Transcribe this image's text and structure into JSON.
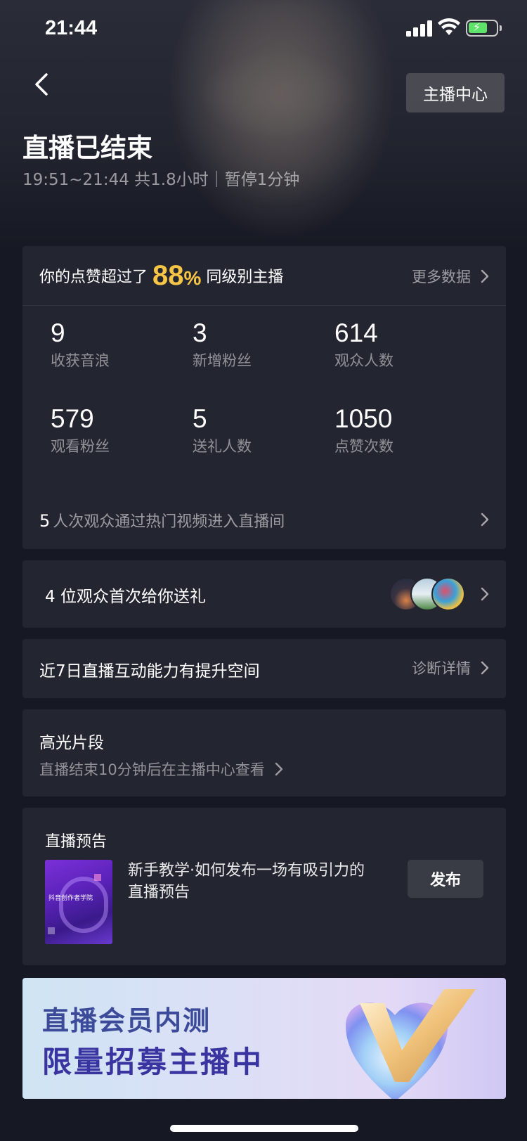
{
  "status_bar": {
    "time": "21:44"
  },
  "header": {
    "host_center_label": "主播中心",
    "title": "直播已结束",
    "subtitle": "19:51~21:44 共1.8小时｜暂停1分钟"
  },
  "summary": {
    "prefix": "你的点赞超过了",
    "percent": "88",
    "percent_unit": "%",
    "suffix": "同级别主播",
    "more_label": "更多数据",
    "stats": [
      {
        "value": "9",
        "label": "收获音浪"
      },
      {
        "value": "3",
        "label": "新增粉丝"
      },
      {
        "value": "614",
        "label": "观众人数"
      },
      {
        "value": "579",
        "label": "观看粉丝"
      },
      {
        "value": "5",
        "label": "送礼人数"
      },
      {
        "value": "1050",
        "label": "点赞次数"
      }
    ],
    "hot_count": "5",
    "hot_text": "人次观众通过热门视频进入直播间"
  },
  "gifts": {
    "text": "4 位观众首次给你送礼"
  },
  "interaction": {
    "text": "近7日直播互动能力有提升空间",
    "link_label": "诊断详情"
  },
  "highlights": {
    "title": "高光片段",
    "subtitle": "直播结束10分钟后在主播中心查看"
  },
  "preview": {
    "title": "直播预告",
    "thumb_text": "抖音创作者学院",
    "description": "新手教学·如何发布一场有吸引力的直播预告",
    "publish_label": "发布"
  },
  "banner": {
    "line1": "直播会员内测",
    "line2": "限量招募主播中"
  },
  "colors": {
    "accent_gold": "#f7c546",
    "background": "#161823",
    "card": "#232530"
  }
}
